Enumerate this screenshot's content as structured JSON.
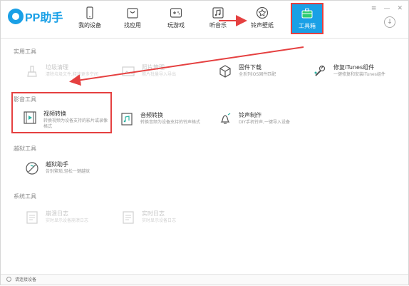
{
  "app": {
    "logo_text": "PP助手"
  },
  "nav": {
    "tabs": [
      {
        "label": "我的设备",
        "icon": "phone-icon"
      },
      {
        "label": "找应用",
        "icon": "store-bag-icon"
      },
      {
        "label": "玩游戏",
        "icon": "gamepad-icon"
      },
      {
        "label": "听音乐",
        "icon": "music-icon"
      },
      {
        "label": "铃声壁纸",
        "icon": "star-icon"
      },
      {
        "label": "工具箱",
        "icon": "toolbox-icon",
        "active": true
      }
    ]
  },
  "sections": [
    {
      "title": "实用工具",
      "tools": [
        {
          "title": "垃圾清理",
          "desc": "清除垃圾文件,释放更多空间",
          "icon": "broom-icon",
          "enabled": false
        },
        {
          "title": "照片管理",
          "desc": "照片批量导入导出",
          "icon": "photo-icon",
          "enabled": false
        },
        {
          "title": "固件下载",
          "desc": "全系列iOS固件匹配",
          "icon": "cube-icon",
          "enabled": true
        },
        {
          "title": "修复iTunes组件",
          "desc": "一键修复和安装iTunes组件",
          "icon": "wrench-icon",
          "enabled": true
        }
      ]
    },
    {
      "title": "影音工具",
      "tools": [
        {
          "title": "视频转换",
          "desc": "转换视频为设备支持的影片或录像格式",
          "icon": "video-convert-icon",
          "enabled": true
        },
        {
          "title": "音频转换",
          "desc": "转换音频为设备支持的铃声格式",
          "icon": "audio-convert-icon",
          "enabled": true
        },
        {
          "title": "铃声制作",
          "desc": "DIY手机铃声,一键导入设备",
          "icon": "bell-icon",
          "enabled": true
        }
      ]
    },
    {
      "title": "越狱工具",
      "tools": [
        {
          "title": "越狱助手",
          "desc": "告别繁琐,轻松一键越狱",
          "icon": "jailbreak-icon",
          "enabled": true
        }
      ]
    },
    {
      "title": "系统工具",
      "tools": [
        {
          "title": "崩溃日志",
          "desc": "实时显示设备崩溃日志",
          "icon": "log-icon",
          "enabled": false
        },
        {
          "title": "实时日志",
          "desc": "实时显示设备日志",
          "icon": "log-icon",
          "enabled": false
        }
      ]
    }
  ],
  "status": {
    "text": "请连接设备"
  },
  "colors": {
    "accent": "#1aa0e6",
    "annotation": "#e54040"
  }
}
